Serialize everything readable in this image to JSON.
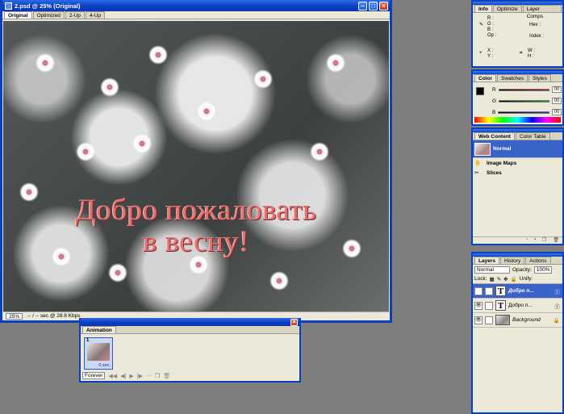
{
  "document": {
    "title": "2.psd @ 25% (Original)",
    "tabs": [
      "Original",
      "Optimized",
      "2-Up",
      "4-Up"
    ],
    "greeting_line1": "Добро пожаловать",
    "greeting_line2": "в весну!",
    "zoom": "25%",
    "status": "-- / -- sec @ 28.8 Kbps"
  },
  "animation": {
    "tab": "Animation",
    "frame_number": "1",
    "frame_delay": "0 sec.",
    "loop": "Forever"
  },
  "info_panel": {
    "tabs": [
      "Info",
      "Optimize",
      "Layer Comps"
    ],
    "labels": {
      "r": "R :",
      "g": "G :",
      "b": "B :",
      "op": "Op :",
      "hex": "Hex :",
      "index": "Index :",
      "x": "X :",
      "y": "Y :",
      "w": "W :",
      "h": "H :"
    }
  },
  "color_panel": {
    "tabs": [
      "Color",
      "Swatches",
      "Styles"
    ],
    "channels": [
      {
        "label": "R",
        "value": "00",
        "color": "#d01818"
      },
      {
        "label": "G",
        "value": "00",
        "color": "#18b018"
      },
      {
        "label": "B",
        "value": "00",
        "color": "#1838d0"
      }
    ]
  },
  "web_panel": {
    "tabs": [
      "Web Content",
      "Color Table"
    ],
    "items": [
      "Normal",
      "Image Maps",
      "Slices"
    ]
  },
  "layers_panel": {
    "tabs": [
      "Layers",
      "History",
      "Actions"
    ],
    "blend_mode": "Normal",
    "opacity_label": "Opacity:",
    "opacity": "100%",
    "lock_label": "Lock:",
    "unify_label": "Unify:",
    "layers": [
      {
        "name": "Добро п...",
        "selected": true
      },
      {
        "name": "Добро п...",
        "selected": false
      },
      {
        "name": "Background",
        "selected": false
      }
    ]
  },
  "colors": {
    "accent": "#0a3fc2",
    "selection": "#3a63c9",
    "workspace": "#7f7f7f",
    "panel": "#ece9d8"
  }
}
